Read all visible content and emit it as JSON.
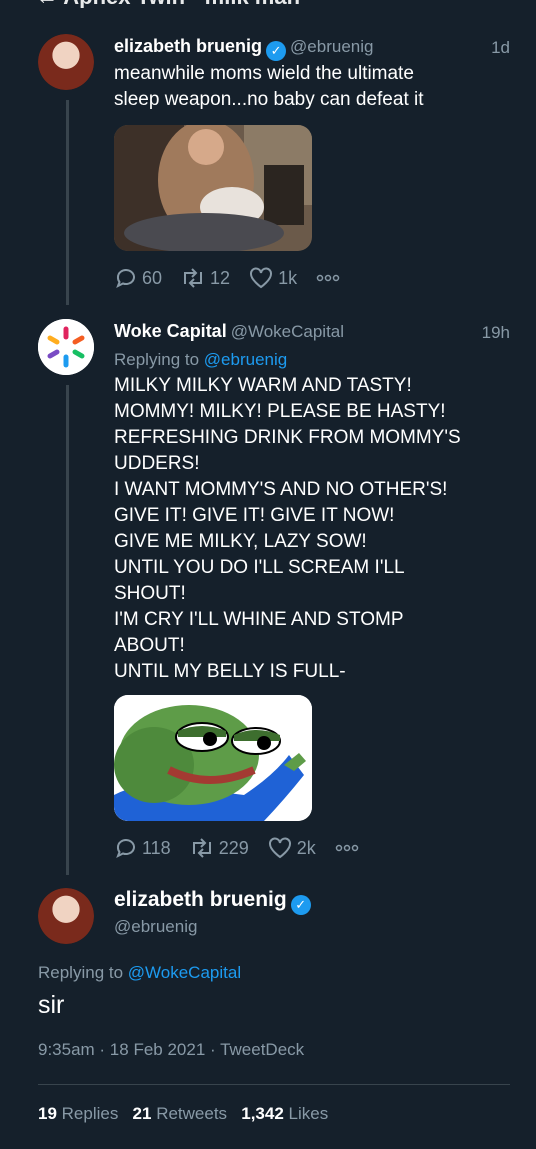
{
  "top_bar": {
    "text": "← Aphex Twin · milk man"
  },
  "tweets": [
    {
      "name": "elizabeth bruenig",
      "handle": "@ebruenig",
      "time": "1d",
      "text_lines": [
        "meanwhile moms wield the ultimate",
        "sleep weapon...no baby can defeat it"
      ],
      "stats": {
        "replies": "60",
        "retweets": "12",
        "likes": "1k"
      }
    },
    {
      "name": "Woke Capital",
      "handle": "@WokeCapital",
      "time": "19h",
      "reply_prefix": "Replying to ",
      "reply_to": "@ebruenig",
      "text_lines": [
        "MILKY MILKY WARM AND TASTY!",
        "MOMMY! MILKY! PLEASE BE HASTY!",
        "REFRESHING DRINK FROM MOMMY'S",
        "UDDERS!",
        "I WANT MOMMY'S AND NO OTHER'S!",
        "GIVE IT! GIVE IT! GIVE IT NOW!",
        "GIVE ME MILKY, LAZY SOW!",
        "UNTIL YOU DO I'LL SCREAM I'LL",
        "SHOUT!",
        "I'M CRY I'LL WHINE AND STOMP",
        "ABOUT!",
        "UNTIL MY BELLY IS FULL-"
      ],
      "stats": {
        "replies": "118",
        "retweets": "229",
        "likes": "2k"
      }
    }
  ],
  "main_tweet": {
    "name": "elizabeth bruenig",
    "handle": "@ebruenig",
    "reply_prefix": "Replying to ",
    "reply_to": "@WokeCapital",
    "text": "sir",
    "meta": "9:35am · 18 Feb 2021 · TweetDeck",
    "replies_count": "19",
    "replies_label": "Replies",
    "retweets_count": "21",
    "retweets_label": "Retweets",
    "likes_count": "1,342",
    "likes_label": "Likes"
  },
  "icons": [
    "reply-icon",
    "retweet-icon",
    "like-icon",
    "more-icon",
    "verified-badge-icon"
  ],
  "colors": {
    "background": "#15202b",
    "accent": "#1d9bf0",
    "muted": "#8899a6"
  }
}
